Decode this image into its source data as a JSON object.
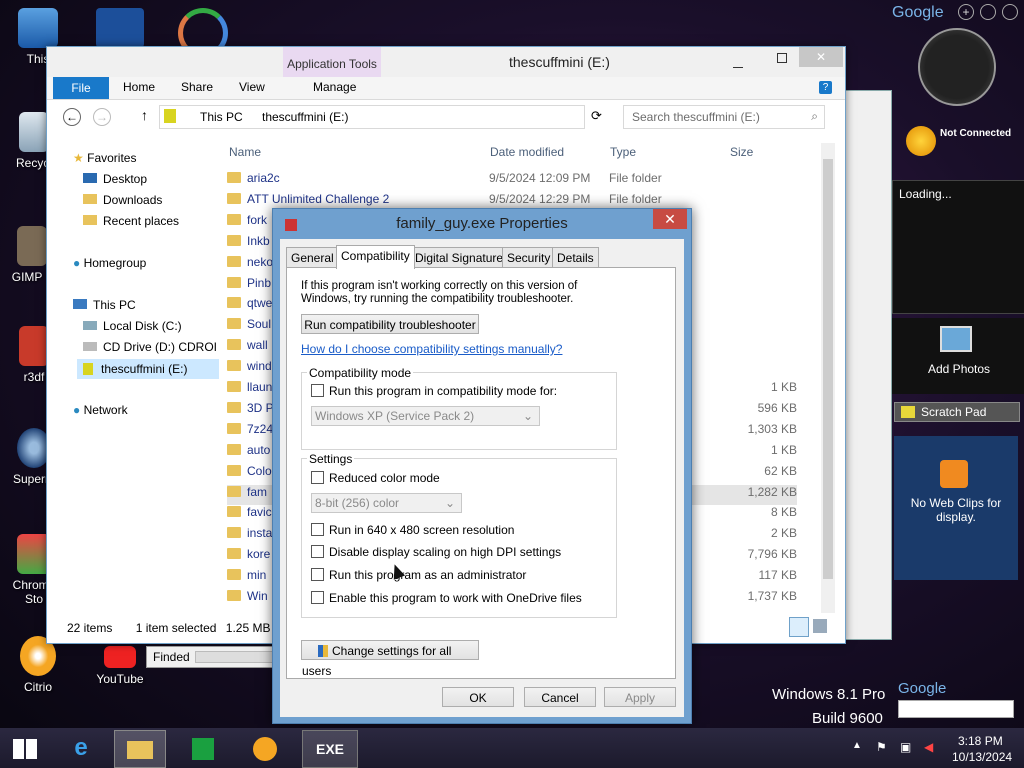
{
  "desktop": {
    "icons": [
      {
        "label": "This"
      },
      {
        "label": "Recycl"
      },
      {
        "label": "GIMP 2"
      },
      {
        "label": "r3df"
      },
      {
        "label": "Superm"
      },
      {
        "label": "Chrome Sto"
      },
      {
        "label": "Citrio"
      },
      {
        "label": "YouTube"
      }
    ],
    "os_name": "Windows 8.1 Pro",
    "os_build": "Build 9600"
  },
  "explorer": {
    "title": "thescuffmini (E:)",
    "app_tools": "Application Tools",
    "tabs": [
      "File",
      "Home",
      "Share",
      "View",
      "Manage"
    ],
    "address": [
      "This PC",
      "thescuffmini (E:)"
    ],
    "search_placeholder": "Search thescuffmini (E:)",
    "nav": {
      "favorites": "Favorites",
      "desktop": "Desktop",
      "downloads": "Downloads",
      "recent": "Recent places",
      "homegroup": "Homegroup",
      "thispc": "This PC",
      "localdisk": "Local Disk (C:)",
      "cddrive": "CD Drive (D:) CDROI",
      "thescuffmini": "thescuffmini (E:)",
      "network": "Network"
    },
    "columns": {
      "name": "Name",
      "date": "Date modified",
      "type": "Type",
      "size": "Size"
    },
    "rows": [
      {
        "name": "aria2c",
        "date": "9/5/2024 12:09 PM",
        "type": "File folder",
        "size": ""
      },
      {
        "name": "ATT Unlimited Challenge 2",
        "date": "9/5/2024 12:29 PM",
        "type": "File folder",
        "size": ""
      },
      {
        "name": "fork",
        "date": "",
        "type": "",
        "size": ""
      },
      {
        "name": "Inkb",
        "date": "",
        "type": "",
        "size": ""
      },
      {
        "name": "neko",
        "date": "",
        "type": "",
        "size": ""
      },
      {
        "name": "Pinb",
        "date": "",
        "type": "",
        "size": ""
      },
      {
        "name": "qtwe",
        "date": "",
        "type": "",
        "size": ""
      },
      {
        "name": "Soul",
        "date": "",
        "type": "",
        "size": ""
      },
      {
        "name": "wall",
        "date": "",
        "type": "",
        "size": ""
      },
      {
        "name": "wind",
        "date": "",
        "type": "",
        "size": ""
      },
      {
        "name": "llaun",
        "date": "",
        "type": "File",
        "size": "1 KB"
      },
      {
        "name": "3D P",
        "date": "",
        "type": "",
        "size": "596 KB"
      },
      {
        "name": "7z24",
        "date": "",
        "type": "",
        "size": "1,303 KB"
      },
      {
        "name": "auto",
        "date": "",
        "type": "on",
        "size": "1 KB"
      },
      {
        "name": "Colo",
        "date": "",
        "type": "",
        "size": "62 KB"
      },
      {
        "name": "fam",
        "date": "",
        "type": "",
        "size": "1,282 KB"
      },
      {
        "name": "favic",
        "date": "",
        "type": "",
        "size": "8 KB"
      },
      {
        "name": "insta",
        "date": "",
        "type": "File",
        "size": "2 KB"
      },
      {
        "name": "kore",
        "date": "",
        "type": "",
        "size": "7,796 KB"
      },
      {
        "name": "min",
        "date": "",
        "type": "",
        "size": "117 KB"
      },
      {
        "name": "Win",
        "date": "",
        "type": "pp...",
        "size": "1,737 KB"
      }
    ],
    "status_items": "22 items",
    "status_selected": "1 item selected",
    "status_size": "1.25 MB"
  },
  "finder": {
    "label": "Finded"
  },
  "dialog": {
    "title": "family_guy.exe Properties",
    "tabs": [
      "General",
      "Compatibility",
      "Digital Signatures",
      "Security",
      "Details"
    ],
    "intro": "If this program isn't working correctly on this version of Windows, try running the compatibility troubleshooter.",
    "run_troubleshooter": "Run compatibility troubleshooter",
    "how_link": "How do I choose compatibility settings manually?",
    "compat_group": "Compatibility mode",
    "compat_check": "Run this program in compatibility mode for:",
    "compat_combo": "Windows XP (Service Pack 2)",
    "settings_group": "Settings",
    "reduced_color": "Reduced color mode",
    "color_combo": "8-bit (256) color",
    "res640": "Run in 640 x 480 screen resolution",
    "dpi": "Disable display scaling on high DPI settings",
    "admin": "Run this program as an administrator",
    "onedrive": "Enable this program to work with OneDrive files",
    "change_all": "Change settings for all users",
    "ok": "OK",
    "cancel": "Cancel",
    "apply": "Apply"
  },
  "gadgets": {
    "google": "Google",
    "not_connected": "Not Connected",
    "loading": "Loading...",
    "add_photos": "Add Photos",
    "scratch": "Scratch Pad",
    "webclips": "No Web Clips for display."
  },
  "taskbar": {
    "exe_label": "EXE",
    "time": "3:18 PM",
    "date": "10/13/2024"
  }
}
